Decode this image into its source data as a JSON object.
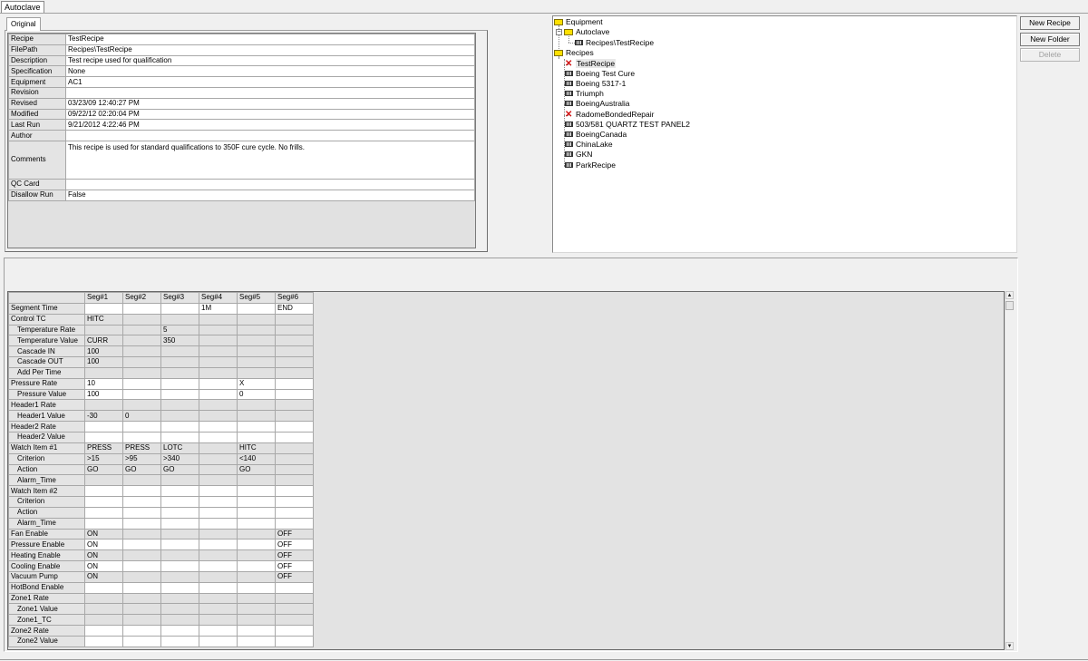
{
  "window": {
    "tab_label": "Autoclave"
  },
  "properties": {
    "tab_label": "Original",
    "rows": [
      {
        "label": "Recipe",
        "value": "TestRecipe"
      },
      {
        "label": "FilePath",
        "value": "Recipes\\TestRecipe"
      },
      {
        "label": "Description",
        "value": "Test recipe used for qualification"
      },
      {
        "label": "Specification",
        "value": "None"
      },
      {
        "label": "Equipment",
        "value": "AC1"
      },
      {
        "label": "Revision",
        "value": ""
      },
      {
        "label": "Revised",
        "value": "03/23/09  12:40:27 PM"
      },
      {
        "label": "Modified",
        "value": "09/22/12  02:20:04 PM"
      },
      {
        "label": "Last Run",
        "value": "9/21/2012 4:22:46 PM"
      },
      {
        "label": "Author",
        "value": ""
      },
      {
        "label": "Comments",
        "value": "This recipe is used for standard qualifications to 350F cure cycle.  No frills."
      },
      {
        "label": "QC Card",
        "value": ""
      },
      {
        "label": "Disallow Run",
        "value": "False"
      }
    ]
  },
  "tree": {
    "equipment": "Equipment",
    "autoclave": "Autoclave",
    "autoclave_recipe": "Recipes\\TestRecipe",
    "recipes_folder": "Recipes",
    "recipes": [
      {
        "name": "TestRecipe",
        "icon": "error-x-icon"
      },
      {
        "name": "Boeing Test Cure",
        "icon": "recipe-grid-icon"
      },
      {
        "name": "Boeing 5317-1",
        "icon": "recipe-grid-icon"
      },
      {
        "name": "Triumph",
        "icon": "recipe-grid-icon"
      },
      {
        "name": "BoeingAustralia",
        "icon": "recipe-grid-icon"
      },
      {
        "name": "RadomeBondedRepair",
        "icon": "error-x-icon"
      },
      {
        "name": "503/581 QUARTZ TEST PANEL2",
        "icon": "recipe-grid-icon"
      },
      {
        "name": "BoeingCanada",
        "icon": "recipe-grid-icon"
      },
      {
        "name": "ChinaLake",
        "icon": "recipe-grid-icon"
      },
      {
        "name": "GKN",
        "icon": "recipe-grid-icon"
      },
      {
        "name": "ParkRecipe",
        "icon": "recipe-grid-icon"
      }
    ]
  },
  "buttons": {
    "new_recipe": "New Recipe",
    "new_folder": "New Folder",
    "delete": "Delete"
  },
  "segments": {
    "headers": [
      "Seg#1",
      "Seg#2",
      "Seg#3",
      "Seg#4",
      "Seg#5",
      "Seg#6"
    ],
    "rows": [
      {
        "label": "Segment Time",
        "sub": false,
        "cells": [
          "",
          "",
          "",
          "1M",
          "",
          "END"
        ]
      },
      {
        "label": "Control TC",
        "sub": false,
        "cells": [
          "HITC",
          "",
          "",
          "",
          "",
          ""
        ]
      },
      {
        "label": "Temperature Rate",
        "sub": true,
        "cells": [
          "",
          "",
          "5",
          "",
          "",
          ""
        ]
      },
      {
        "label": "Temperature Value",
        "sub": true,
        "cells": [
          "CURR",
          "",
          "350",
          "",
          "",
          ""
        ]
      },
      {
        "label": "Cascade IN",
        "sub": true,
        "cells": [
          "100",
          "",
          "",
          "",
          "",
          ""
        ]
      },
      {
        "label": "Cascade OUT",
        "sub": true,
        "cells": [
          "100",
          "",
          "",
          "",
          "",
          ""
        ]
      },
      {
        "label": "Add Per Time",
        "sub": true,
        "cells": [
          "",
          "",
          "",
          "",
          "",
          ""
        ]
      },
      {
        "label": "Pressure Rate",
        "sub": false,
        "cells": [
          "10",
          "",
          "",
          "",
          "X",
          ""
        ]
      },
      {
        "label": "Pressure Value",
        "sub": true,
        "cells": [
          "100",
          "",
          "",
          "",
          "0",
          ""
        ]
      },
      {
        "label": "Header1 Rate",
        "sub": false,
        "cells": [
          "",
          "",
          "",
          "",
          "",
          ""
        ]
      },
      {
        "label": "Header1 Value",
        "sub": true,
        "cells": [
          "-30",
          "0",
          "",
          "",
          "",
          ""
        ]
      },
      {
        "label": "Header2 Rate",
        "sub": false,
        "cells": [
          "",
          "",
          "",
          "",
          "",
          ""
        ]
      },
      {
        "label": "Header2 Value",
        "sub": true,
        "cells": [
          "",
          "",
          "",
          "",
          "",
          ""
        ]
      },
      {
        "label": "Watch Item #1",
        "sub": false,
        "cells": [
          "PRESS",
          "PRESS",
          "LOTC",
          "",
          "HITC",
          ""
        ]
      },
      {
        "label": "Criterion",
        "sub": true,
        "cells": [
          ">15",
          ">95",
          ">340",
          "",
          "<140",
          ""
        ]
      },
      {
        "label": "Action",
        "sub": true,
        "cells": [
          "GO",
          "GO",
          "GO",
          "",
          "GO",
          ""
        ]
      },
      {
        "label": "Alarm_Time",
        "sub": true,
        "cells": [
          "",
          "",
          "",
          "",
          "",
          ""
        ]
      },
      {
        "label": "Watch Item #2",
        "sub": false,
        "cells": [
          "",
          "",
          "",
          "",
          "",
          ""
        ]
      },
      {
        "label": "Criterion",
        "sub": true,
        "cells": [
          "",
          "",
          "",
          "",
          "",
          ""
        ]
      },
      {
        "label": "Action",
        "sub": true,
        "cells": [
          "",
          "",
          "",
          "",
          "",
          ""
        ]
      },
      {
        "label": "Alarm_Time",
        "sub": true,
        "cells": [
          "",
          "",
          "",
          "",
          "",
          ""
        ]
      },
      {
        "label": "Fan Enable",
        "sub": false,
        "cells": [
          "ON",
          "",
          "",
          "",
          "",
          "OFF"
        ]
      },
      {
        "label": "Pressure Enable",
        "sub": false,
        "cells": [
          "ON",
          "",
          "",
          "",
          "",
          "OFF"
        ]
      },
      {
        "label": "Heating Enable",
        "sub": false,
        "cells": [
          "ON",
          "",
          "",
          "",
          "",
          "OFF"
        ]
      },
      {
        "label": "Cooling Enable",
        "sub": false,
        "cells": [
          "ON",
          "",
          "",
          "",
          "",
          "OFF"
        ]
      },
      {
        "label": "Vacuum Pump",
        "sub": false,
        "cells": [
          "ON",
          "",
          "",
          "",
          "",
          "OFF"
        ]
      },
      {
        "label": "HotBond Enable",
        "sub": false,
        "cells": [
          "",
          "",
          "",
          "",
          "",
          ""
        ]
      },
      {
        "label": "Zone1 Rate",
        "sub": false,
        "cells": [
          "",
          "",
          "",
          "",
          "",
          ""
        ]
      },
      {
        "label": "Zone1 Value",
        "sub": true,
        "cells": [
          "",
          "",
          "",
          "",
          "",
          ""
        ]
      },
      {
        "label": "Zone1_TC",
        "sub": true,
        "cells": [
          "",
          "",
          "",
          "",
          "",
          ""
        ]
      },
      {
        "label": "Zone2 Rate",
        "sub": false,
        "cells": [
          "",
          "",
          "",
          "",
          "",
          ""
        ]
      },
      {
        "label": "Zone2 Value",
        "sub": true,
        "cells": [
          "",
          "",
          "",
          "",
          "",
          ""
        ]
      }
    ]
  }
}
